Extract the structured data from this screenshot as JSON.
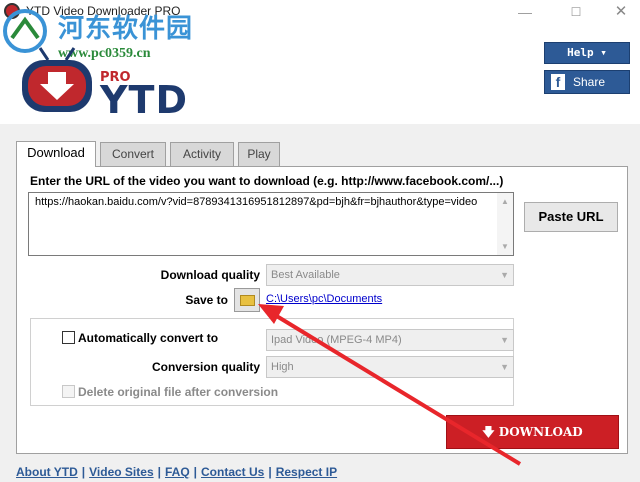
{
  "window": {
    "title": "YTD Video Downloader PRO",
    "minimize_glyph": "—",
    "maximize_glyph": "☐",
    "close_glyph": "✕"
  },
  "watermark": {
    "site_name": "河东软件园",
    "url": "www.pc0359.cn"
  },
  "header": {
    "logo_text": "YTD",
    "logo_badge": "PRO",
    "help_label": "Help ▾",
    "share_icon": "f",
    "share_label": "Share"
  },
  "tabs": [
    {
      "label": "Download",
      "active": true
    },
    {
      "label": "Convert",
      "active": false
    },
    {
      "label": "Activity",
      "active": false
    },
    {
      "label": "Play",
      "active": false
    }
  ],
  "download": {
    "url_prompt": "Enter the URL of the video you want to download (e.g. http://www.facebook.com/...)",
    "url_value": "https://haokan.baidu.com/v?vid=8789341316951812897&pd=bjh&fr=bjhauthor&type=video",
    "paste_label": "Paste URL",
    "quality_label": "Download quality",
    "quality_value": "Best Available",
    "save_to_label": "Save to",
    "save_path": "C:\\Users\\pc\\Documents",
    "auto_convert_label": "Automatically convert to",
    "auto_convert_checked": false,
    "convert_format": "Ipad Video (MPEG-4 MP4)",
    "conversion_quality_label": "Conversion quality",
    "conversion_quality_value": "High",
    "delete_original_label": "Delete original file after conversion",
    "delete_original_checked": false,
    "download_button": "DOWNLOAD",
    "download_icon": "arrow-down-icon"
  },
  "footer": {
    "links": [
      "About YTD",
      "Video Sites",
      "FAQ",
      "Contact Us",
      "Respect IP"
    ]
  },
  "colors": {
    "brand_blue": "#2d5a96",
    "download_red": "#cc1f25",
    "annotation_red": "#e8262b"
  }
}
